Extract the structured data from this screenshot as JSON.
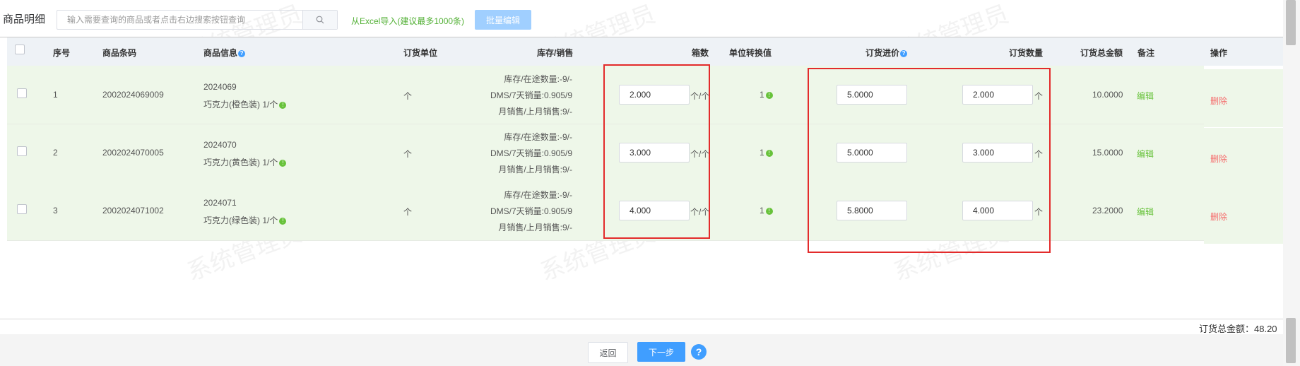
{
  "header": {
    "title": "商品明细",
    "search_placeholder": "输入需要查询的商品或者点击右边搜索按钮查询",
    "excel_link": "从Excel导入(建议最多1000条)",
    "batch_edit": "批量编辑"
  },
  "table": {
    "columns": {
      "seq": "序号",
      "barcode": "商品条码",
      "info": "商品信息",
      "unit": "订货单位",
      "stock": "库存/销售",
      "boxes": "箱数",
      "conversion": "单位转换值",
      "price": "订货进价",
      "qty": "订货数量",
      "total": "订货总金额",
      "remark": "备注",
      "action": "操作"
    },
    "rows": [
      {
        "seq": "1",
        "barcode": "2002024069009",
        "code": "2024069",
        "name": "巧克力(橙色装) 1/个",
        "unit": "个",
        "stock_line1": "库存/在途数量:-9/-",
        "stock_line2": "DMS/7天销量:0.905/9",
        "stock_line3": "月销售/上月销售:9/-",
        "boxes": "2.000",
        "boxes_unit": "个/个",
        "conversion": "1",
        "price": "5.0000",
        "qty": "2.000",
        "qty_unit": "个",
        "total": "10.0000",
        "edit": "编辑",
        "delete": "删除"
      },
      {
        "seq": "2",
        "barcode": "2002024070005",
        "code": "2024070",
        "name": "巧克力(黄色装) 1/个",
        "unit": "个",
        "stock_line1": "库存/在途数量:-9/-",
        "stock_line2": "DMS/7天销量:0.905/9",
        "stock_line3": "月销售/上月销售:9/-",
        "boxes": "3.000",
        "boxes_unit": "个/个",
        "conversion": "1",
        "price": "5.0000",
        "qty": "3.000",
        "qty_unit": "个",
        "total": "15.0000",
        "edit": "编辑",
        "delete": "删除"
      },
      {
        "seq": "3",
        "barcode": "2002024071002",
        "code": "2024071",
        "name": "巧克力(绿色装) 1/个",
        "unit": "个",
        "stock_line1": "库存/在途数量:-9/-",
        "stock_line2": "DMS/7天销量:0.905/9",
        "stock_line3": "月销售/上月销售:9/-",
        "boxes": "4.000",
        "boxes_unit": "个/个",
        "conversion": "1",
        "price": "5.8000",
        "qty": "4.000",
        "qty_unit": "个",
        "total": "23.2000",
        "edit": "编辑",
        "delete": "删除"
      }
    ]
  },
  "footer": {
    "total_label": "订货总金额：48.20",
    "back": "返回",
    "next": "下一步",
    "help": "?"
  },
  "watermark": "系统管理员",
  "colors": {
    "primary": "#409eff",
    "success": "#67c23a",
    "danger": "#f56c6c",
    "highlight_box": "#e32b2b",
    "row_bg": "#eef7e9"
  }
}
